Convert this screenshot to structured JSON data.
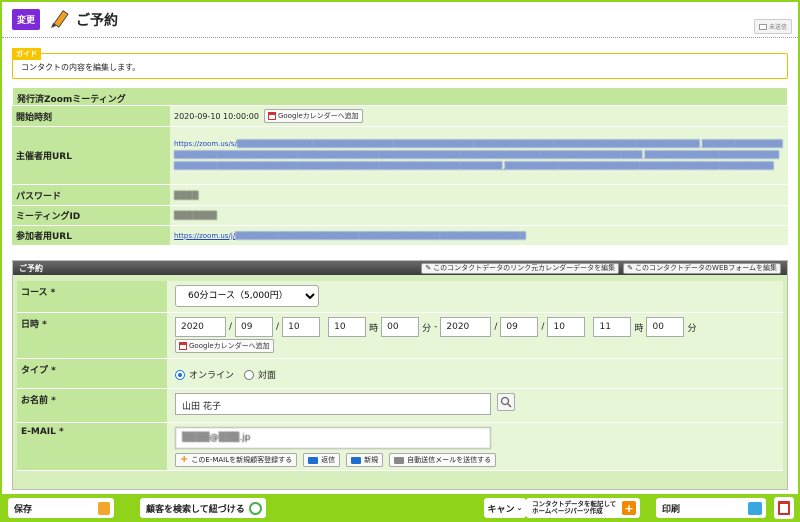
{
  "header": {
    "badge": "変更",
    "title": "ご予約",
    "unsent": "未送信"
  },
  "guide": {
    "tag": "ガイド",
    "text": "コンタクトの内容を編集します。"
  },
  "zoom": {
    "heading": "発行済Zoomミーティング",
    "rows": {
      "start_label": "開始時刻",
      "start_value": "2020-09-10 10:00:00",
      "gcal_label": "Googleカレンダーへ追加",
      "host_label": "主催者用URL",
      "host_url_prefix": "https://zoom.us/s/",
      "password_label": "パスワード",
      "password_value": "▒▒▒▒",
      "meeting_id_label": "ミーティングID",
      "meeting_id_value": "▒▒▒▒▒▒▒",
      "join_label": "参加者用URL",
      "join_url_prefix": "https://zoom.us/j/"
    }
  },
  "reservation": {
    "heading": "ご予約",
    "btn_link": "このコンタクトデータのリンク元カレンダーデータを編集",
    "btn_web": "このコンタクトデータのWEBフォームを編集",
    "course_label": "コース *",
    "course_value": "60分コース（5,000円）",
    "datetime_label": "日時 *",
    "dt": {
      "y1": "2020",
      "m1": "09",
      "d1": "10",
      "h1": "10",
      "mi1": "00",
      "y2": "2020",
      "m2": "09",
      "d2": "10",
      "h2": "11",
      "mi2": "00",
      "slash": "/",
      "hour": "時",
      "minute": "分",
      "dash": "-"
    },
    "gcal_label": "Googleカレンダーへ追加",
    "type_label": "タイプ *",
    "type_online": "オンライン",
    "type_face": "対面",
    "name_label": "お名前 *",
    "name_value": "山田 花子",
    "email_label": "E-MAIL *",
    "email_value": "▒▒▒▒@▒▒▒.jp",
    "btn_register": "このE-MAILを新規顧客登録する",
    "btn_reply": "返信",
    "btn_new": "新規",
    "btn_auto": "自動送信メールを送信する"
  },
  "footer": {
    "save": "保存",
    "search_link": "顧客を検索して紐づける",
    "cancel": "キャン",
    "reprint_line1": "コンタクトデータを転記して",
    "reprint_line2": "ホームページパーツ作成",
    "print": "印刷"
  }
}
